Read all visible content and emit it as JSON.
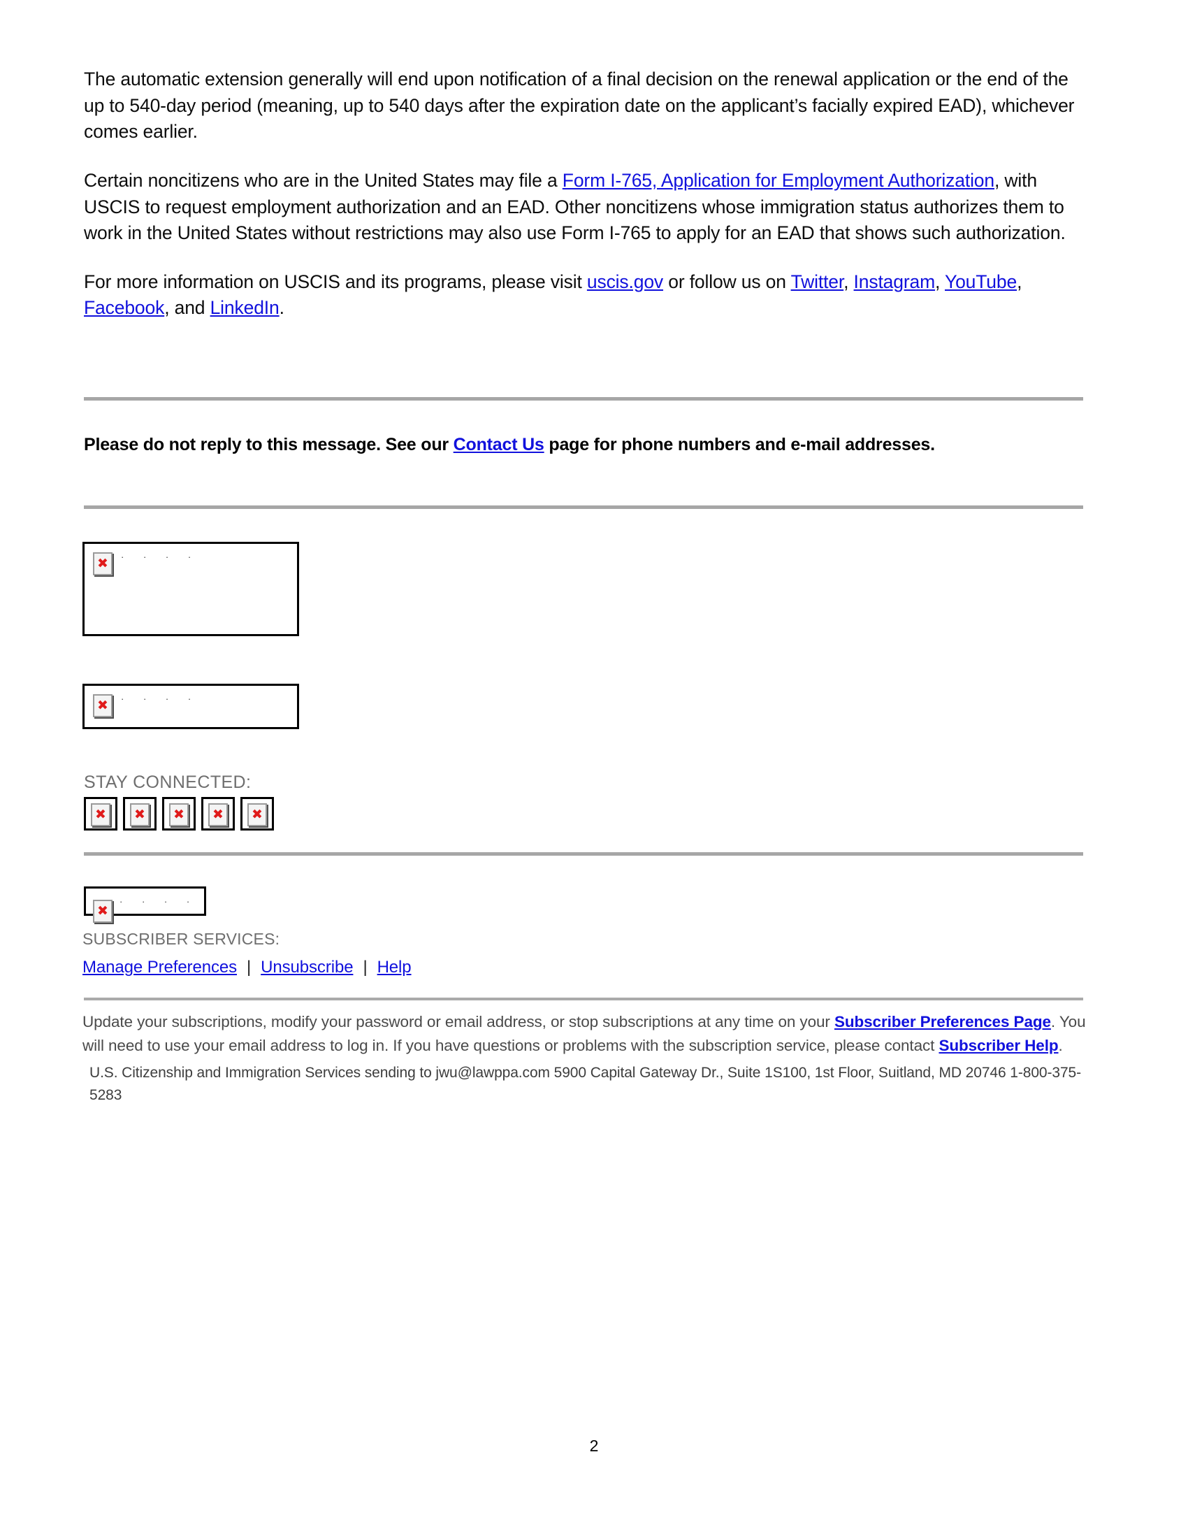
{
  "document": {
    "page_number": "2"
  },
  "paragraphs": {
    "p1": "The automatic extension generally will end upon notification of a final decision on the renewal application or the end of the up to 540-day period (meaning, up to 540 days after the expiration date on the applicant’s facially expired EAD), whichever comes earlier.",
    "p2_before_link": "Certain noncitizens who are in the United States may file a ",
    "p2_link": "Form I-765, Application for Employment Authorization",
    "p2_after_link": ", with USCIS to request employment authorization and an EAD. Other noncitizens whose immigration status authorizes them to work in the United States without restrictions may also use Form I-765 to apply for an EAD that shows such authorization.",
    "p3_before_link": "For more information on USCIS and its programs, please visit ",
    "p3_site_link": "uscis.gov",
    "p3_middle": " or follow us on ",
    "p3_and": ", and ",
    "p3_end": "."
  },
  "social_links": {
    "twitter": "Twitter",
    "instagram": "Instagram",
    "youtube": "YouTube",
    "facebook": "Facebook",
    "linkedin": "LinkedIn",
    "sep": ", "
  },
  "no_reply": {
    "before": "Please do not reply to this message.  See our ",
    "link": "Contact Us",
    "after": " page for phone numbers and e-mail addresses."
  },
  "stay_connected": {
    "label": "STAY CONNECTED:",
    "icons": [
      "social-icon-broken-1",
      "social-icon-broken-2",
      "social-icon-broken-3",
      "social-icon-broken-4",
      "social-icon-broken-5"
    ],
    "broken_glyph": "✖"
  },
  "broken_images": {
    "glyph": "✖",
    "alt_dots": "·  ·  ·  ·",
    "banner_1": "broken-image-banner",
    "banner_2": "broken-image-banner-secondary",
    "banner_3": "broken-image-govdelivery"
  },
  "subscriber_services": {
    "label": "SUBSCRIBER SERVICES:",
    "manage": "Manage Preferences",
    "unsubscribe": "Unsubscribe",
    "help": "Help",
    "separator": "|"
  },
  "footer": {
    "note_part1": "Update your subscriptions, modify your password or email address, or stop subscriptions at any time on your ",
    "note_link1": "Subscriber Preferences Page",
    "note_part2": ". You will need to use your email address to log in. If you have questions or problems with the subscription service, please contact ",
    "note_link2": "Subscriber Help",
    "note_part3": ".",
    "address": "U.S. Citizenship and Immigration Services sending to jwu@lawppa.com  5900 Capital Gateway Dr., Suite 1S100, 1st Floor, Suitland, MD 20746 1-800-375-5283"
  },
  "colors": {
    "link": "#1111dd",
    "rule": "#a6a6a6",
    "muted_text": "#6e6e6e",
    "broken_x": "#e01b1b"
  }
}
